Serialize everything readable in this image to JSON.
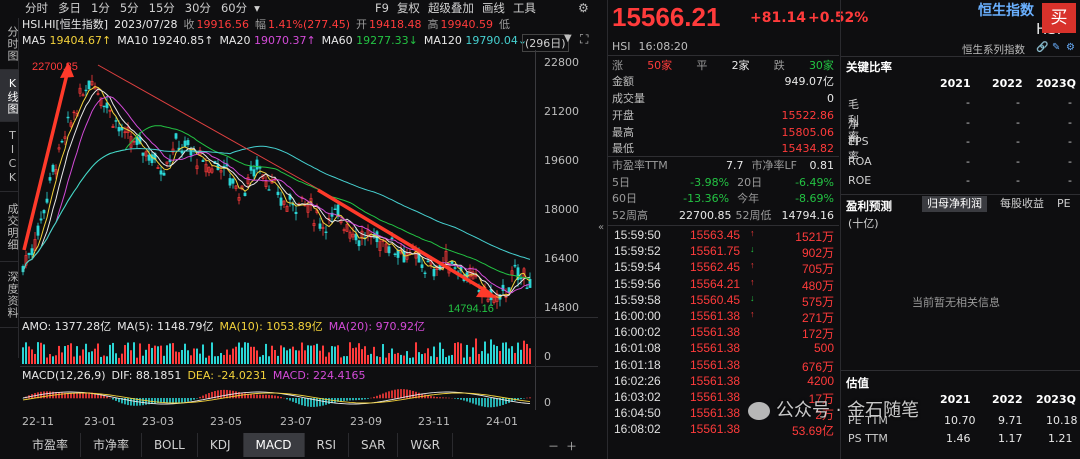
{
  "left_tabs": [
    "分时图",
    "K线图",
    "TICK",
    "成交明细",
    "深度资料"
  ],
  "periods": [
    "分时",
    "多日",
    "1分",
    "5分",
    "15分",
    "30分",
    "60分"
  ],
  "toolbar": {
    "f9": "F9",
    "fuquan": "复权",
    "overlay": "超级叠加",
    "draw": "画线",
    "tools": "工具"
  },
  "info": {
    "code": "HSI.HI[恒生指数]",
    "date": "2023/07/28",
    "close_label": "收",
    "close": "19916.56",
    "amp_label": "幅",
    "amp": "1.41%(277.45)",
    "open_label": "开",
    "open": "19418.48",
    "high_label": "高",
    "high": "19940.59",
    "low_label": "低"
  },
  "ma": [
    {
      "label": "MA5",
      "value": "19404.67↑",
      "color": "#f3d23b"
    },
    {
      "label": "MA10",
      "value": "19240.85↑",
      "color": "#e9e9e9"
    },
    {
      "label": "MA20",
      "value": "19070.37↑",
      "color": "#d34bd8"
    },
    {
      "label": "MA60",
      "value": "19277.33↓",
      "color": "#23c343"
    },
    {
      "label": "MA120",
      "value": "19790.04↓",
      "color": "#46d0d0"
    }
  ],
  "bar_count": "(296日)",
  "y_ticks": [
    "22800",
    "21200",
    "19600",
    "18000",
    "16400",
    "14800"
  ],
  "annotations": {
    "high": "22700.85",
    "low": "14794.16"
  },
  "vol_row": {
    "amo": "AMO: 1377.28亿",
    "ma5": "MA(5): 1148.79亿",
    "ma10": "MA(10): 1053.89亿",
    "ma20": "MA(20): 970.92亿"
  },
  "vol_axis": "0",
  "macd_row": {
    "title": "MACD(12,26,9)",
    "dif": "DIF: 88.1851",
    "dea": "DEA: -24.0231",
    "macd": "MACD: 224.4165"
  },
  "macd_axis": "0",
  "x_ticks": [
    "22-11",
    "23-01",
    "23-03",
    "23-05",
    "23-07",
    "23-09",
    "23-11",
    "24-01"
  ],
  "bottom_tabs": [
    "市盈率",
    "市净率",
    "BOLL",
    "KDJ",
    "MACD",
    "RSI",
    "SAR",
    "W&R"
  ],
  "quote": {
    "price": "15566.21",
    "change": "+81.14",
    "change_pct": "+0.52%",
    "code": "HSI",
    "time": "16:08:20",
    "up_label": "涨",
    "up": "50家",
    "flat_label": "平",
    "flat": "2家",
    "down_label": "跌",
    "down": "30家",
    "rows": [
      {
        "l": "金额",
        "v": "949.07亿",
        "c": "white"
      },
      {
        "l": "成交量",
        "v": "0",
        "c": "white"
      },
      {
        "l": "开盘",
        "v": "15522.86",
        "c": "red"
      },
      {
        "l": "最高",
        "v": "15805.06",
        "c": "red"
      },
      {
        "l": "最低",
        "v": "15434.82",
        "c": "red"
      }
    ],
    "pe_label": "市盈率TTM",
    "pe": "7.7",
    "pb_label": "市净率LF",
    "pb": "0.81",
    "d5_label": "5日",
    "d5": "-3.98%",
    "d20_label": "20日",
    "d20": "-6.49%",
    "d60_label": "60日",
    "d60": "-13.36%",
    "ytd_label": "今年",
    "ytd": "-8.69%",
    "w52h_label": "52周高",
    "w52h": "22700.85",
    "w52l_label": "52周低",
    "w52l": "14794.16"
  },
  "ticks": [
    {
      "t": "15:59:50",
      "p": "15563.45",
      "d": "up",
      "v": "1521万"
    },
    {
      "t": "15:59:52",
      "p": "15561.75",
      "d": "down",
      "v": "902万"
    },
    {
      "t": "15:59:54",
      "p": "15562.45",
      "d": "up",
      "v": "705万"
    },
    {
      "t": "15:59:56",
      "p": "15564.21",
      "d": "up",
      "v": "480万"
    },
    {
      "t": "15:59:58",
      "p": "15560.45",
      "d": "down",
      "v": "575万"
    },
    {
      "t": "16:00:00",
      "p": "15561.38",
      "d": "up",
      "v": "271万"
    },
    {
      "t": "16:00:02",
      "p": "15561.38",
      "d": "",
      "v": "172万"
    },
    {
      "t": "16:01:08",
      "p": "15561.38",
      "d": "",
      "v": "500"
    },
    {
      "t": "16:01:18",
      "p": "15561.38",
      "d": "",
      "v": "676万"
    },
    {
      "t": "16:02:26",
      "p": "15561.38",
      "d": "",
      "v": "4200"
    },
    {
      "t": "16:03:02",
      "p": "15561.38",
      "d": "",
      "v": "17万"
    },
    {
      "t": "16:04:50",
      "p": "15561.38",
      "d": "",
      "v": "2万"
    },
    {
      "t": "16:08:02",
      "p": "15561.38",
      "d": "",
      "v": "53.69亿"
    }
  ],
  "right": {
    "name": "恒生指数",
    "code": "HSI",
    "buy": "买",
    "series": "恒生系列指数",
    "key_ratio_title": "关键比率",
    "years": [
      "2021",
      "2022",
      "2023Q"
    ],
    "ratios": [
      "毛利率",
      "净利率",
      "EPS",
      "ROA",
      "ROE"
    ],
    "dash": "-",
    "profit_title": "盈利预测",
    "profit_tabs": [
      "归母净利润",
      "每股收益",
      "PE"
    ],
    "unit": "(十亿)",
    "no_info": "当前暂无相关信息",
    "valuation_title": "估值",
    "val_years": [
      "2021",
      "2022",
      "2023Q"
    ],
    "pe_ttm_label": "PE TTM",
    "pe_ttm": [
      "10.70",
      "9.71",
      "10.18"
    ],
    "ps_ttm_label": "PS TTM",
    "ps_ttm": [
      "1.46",
      "1.17",
      "1.21"
    ]
  },
  "watermark": "公众号 · 金石随笔"
}
